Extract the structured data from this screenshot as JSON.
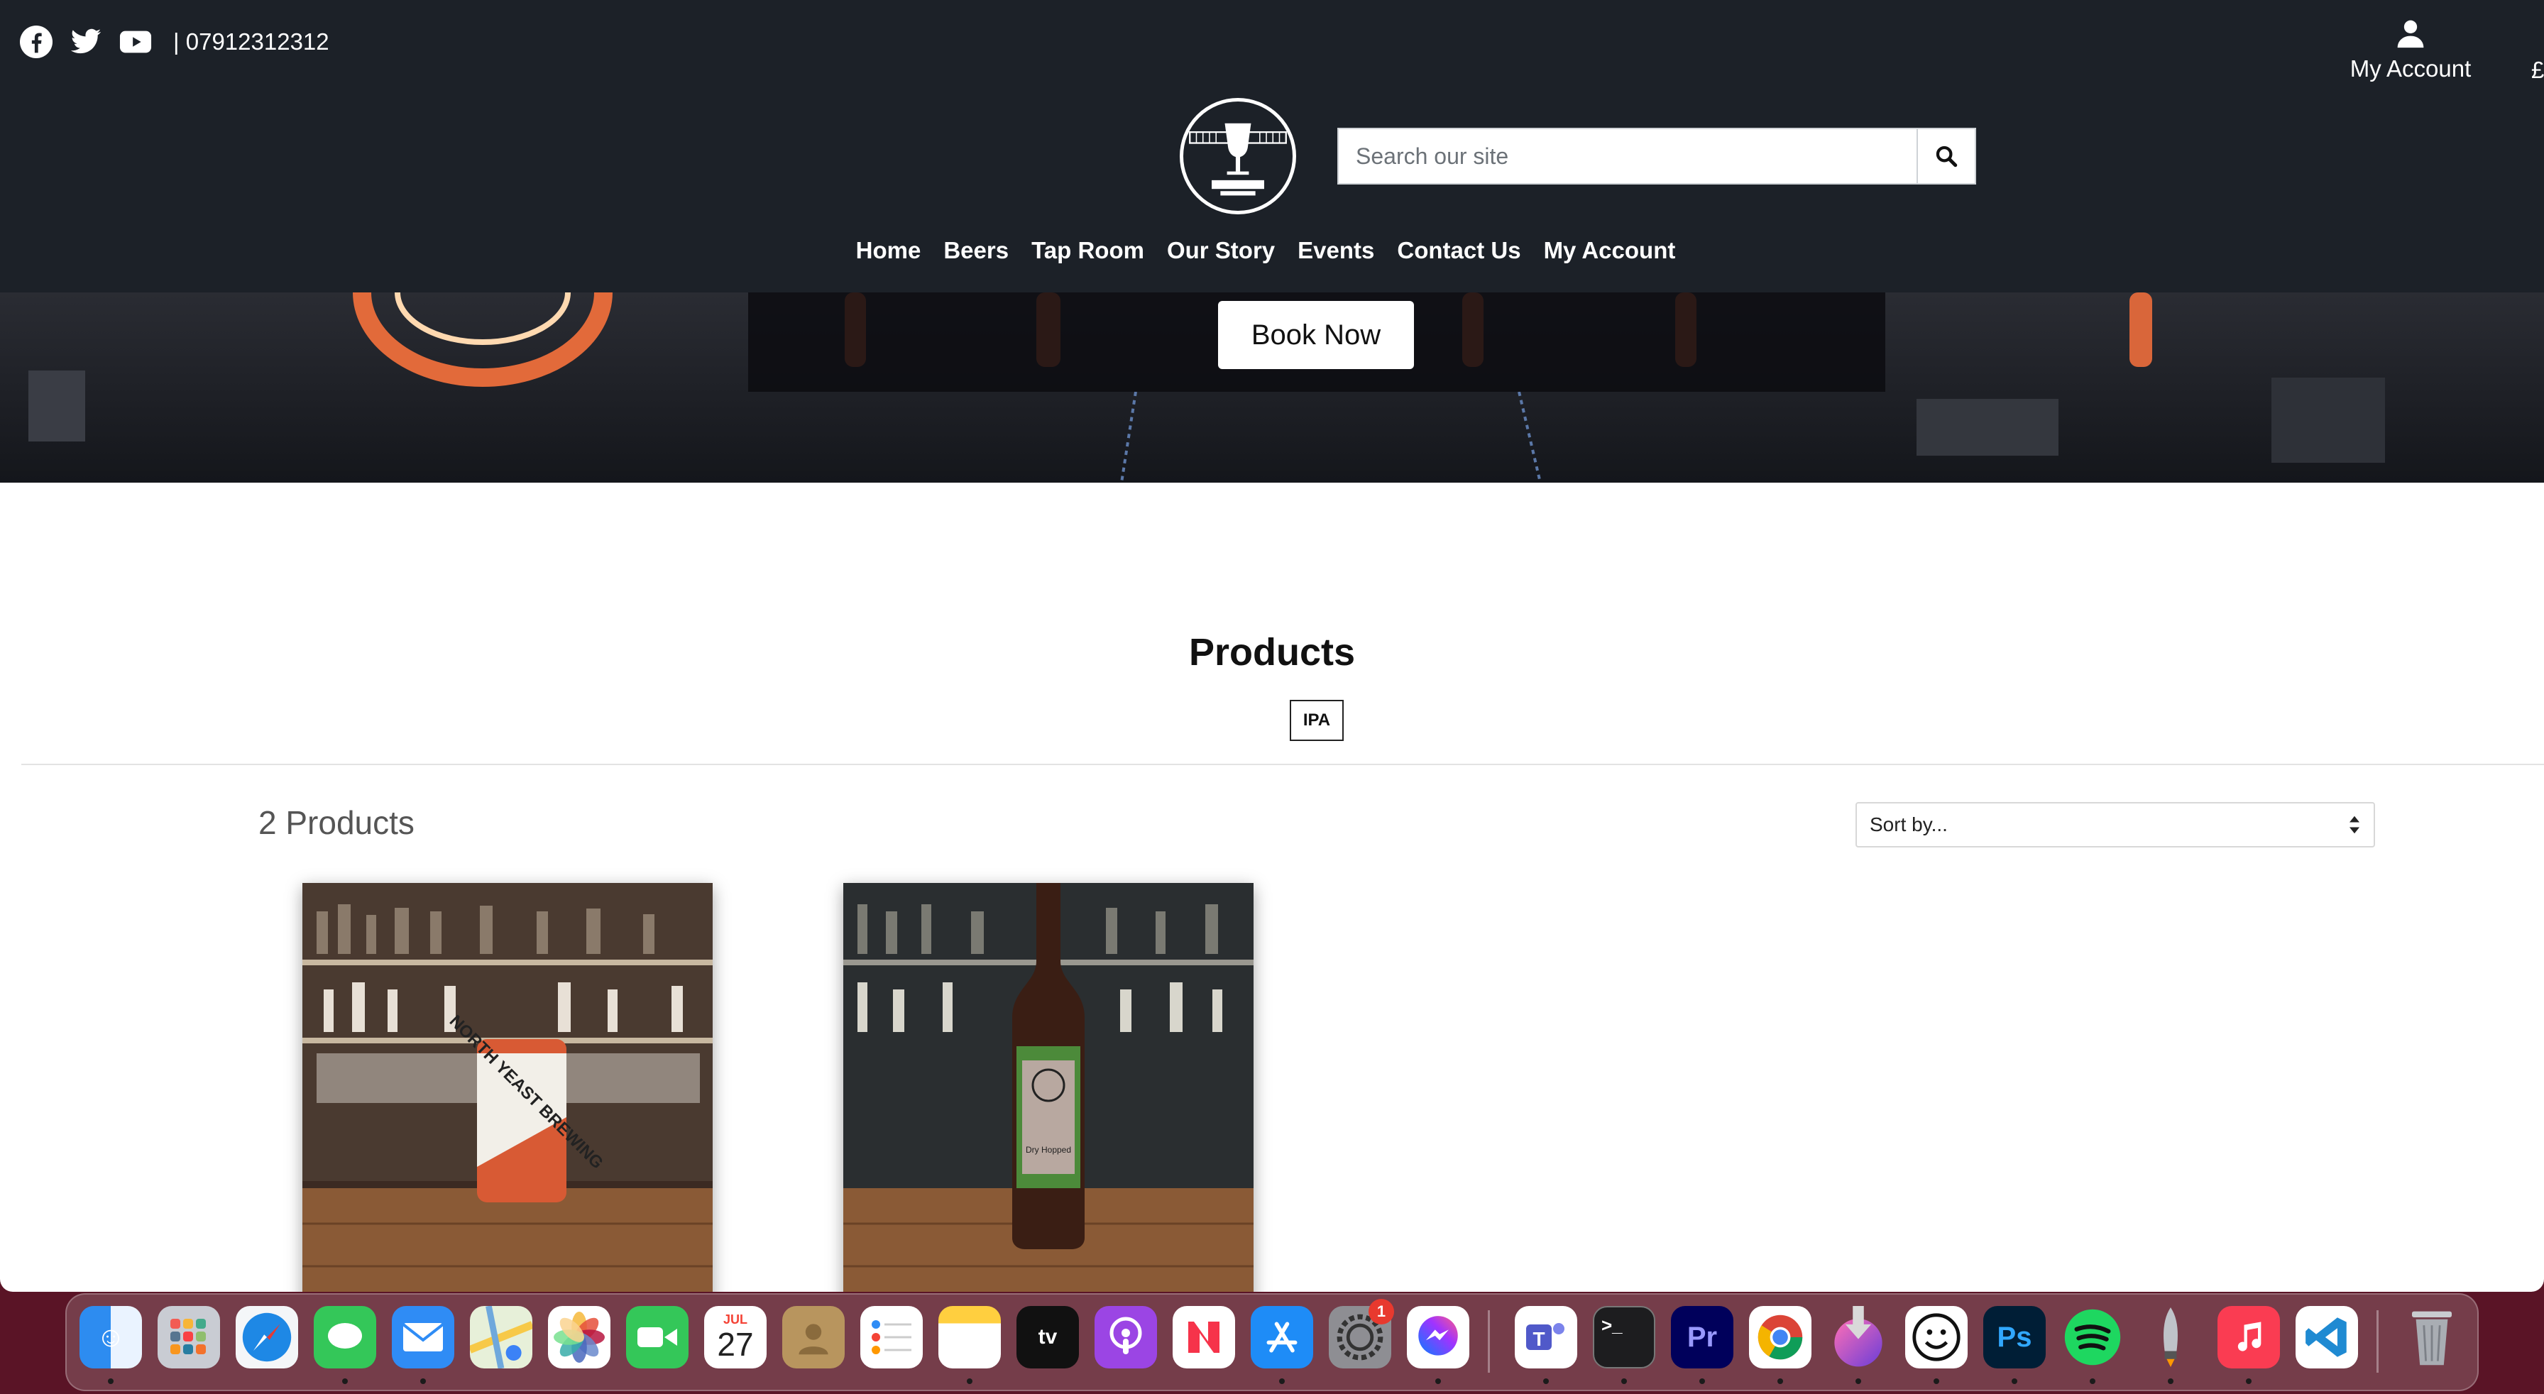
{
  "header": {
    "phone": "| 07912312312",
    "account_label": "My Account",
    "currency": "£",
    "search_placeholder": "Search our site",
    "nav": [
      "Home",
      "Beers",
      "Tap Room",
      "Our Story",
      "Events",
      "Contact Us",
      "My Account"
    ]
  },
  "hero": {
    "button_label": "Book Now"
  },
  "products": {
    "title": "Products",
    "tag": "IPA",
    "count": "2 Products",
    "sort_label": "Sort by...",
    "items": [
      {
        "can_text": "NORTH YEAST BREWING"
      },
      {
        "bottle_text": "Dry Hopped"
      }
    ]
  },
  "dock": {
    "calendar_month": "JUL",
    "calendar_day": "27",
    "settings_badge": "1",
    "apps": [
      "finder-icon",
      "launchpad-icon",
      "safari-icon",
      "messages-icon",
      "mail-icon",
      "maps-icon",
      "photos-icon",
      "facetime-icon",
      "calendar-icon",
      "contacts-icon",
      "reminders-icon",
      "notes-icon",
      "appletv-icon",
      "podcasts-icon",
      "news-icon",
      "appstore-icon",
      "settings-icon",
      "messenger-icon",
      "teams-icon",
      "terminal-icon",
      "premiere-icon",
      "chrome-icon",
      "downloads-icon",
      "emoji-icon",
      "photoshop-icon",
      "spotify-icon",
      "rocket-icon",
      "music-icon",
      "vscode-icon",
      "trash-icon"
    ]
  }
}
